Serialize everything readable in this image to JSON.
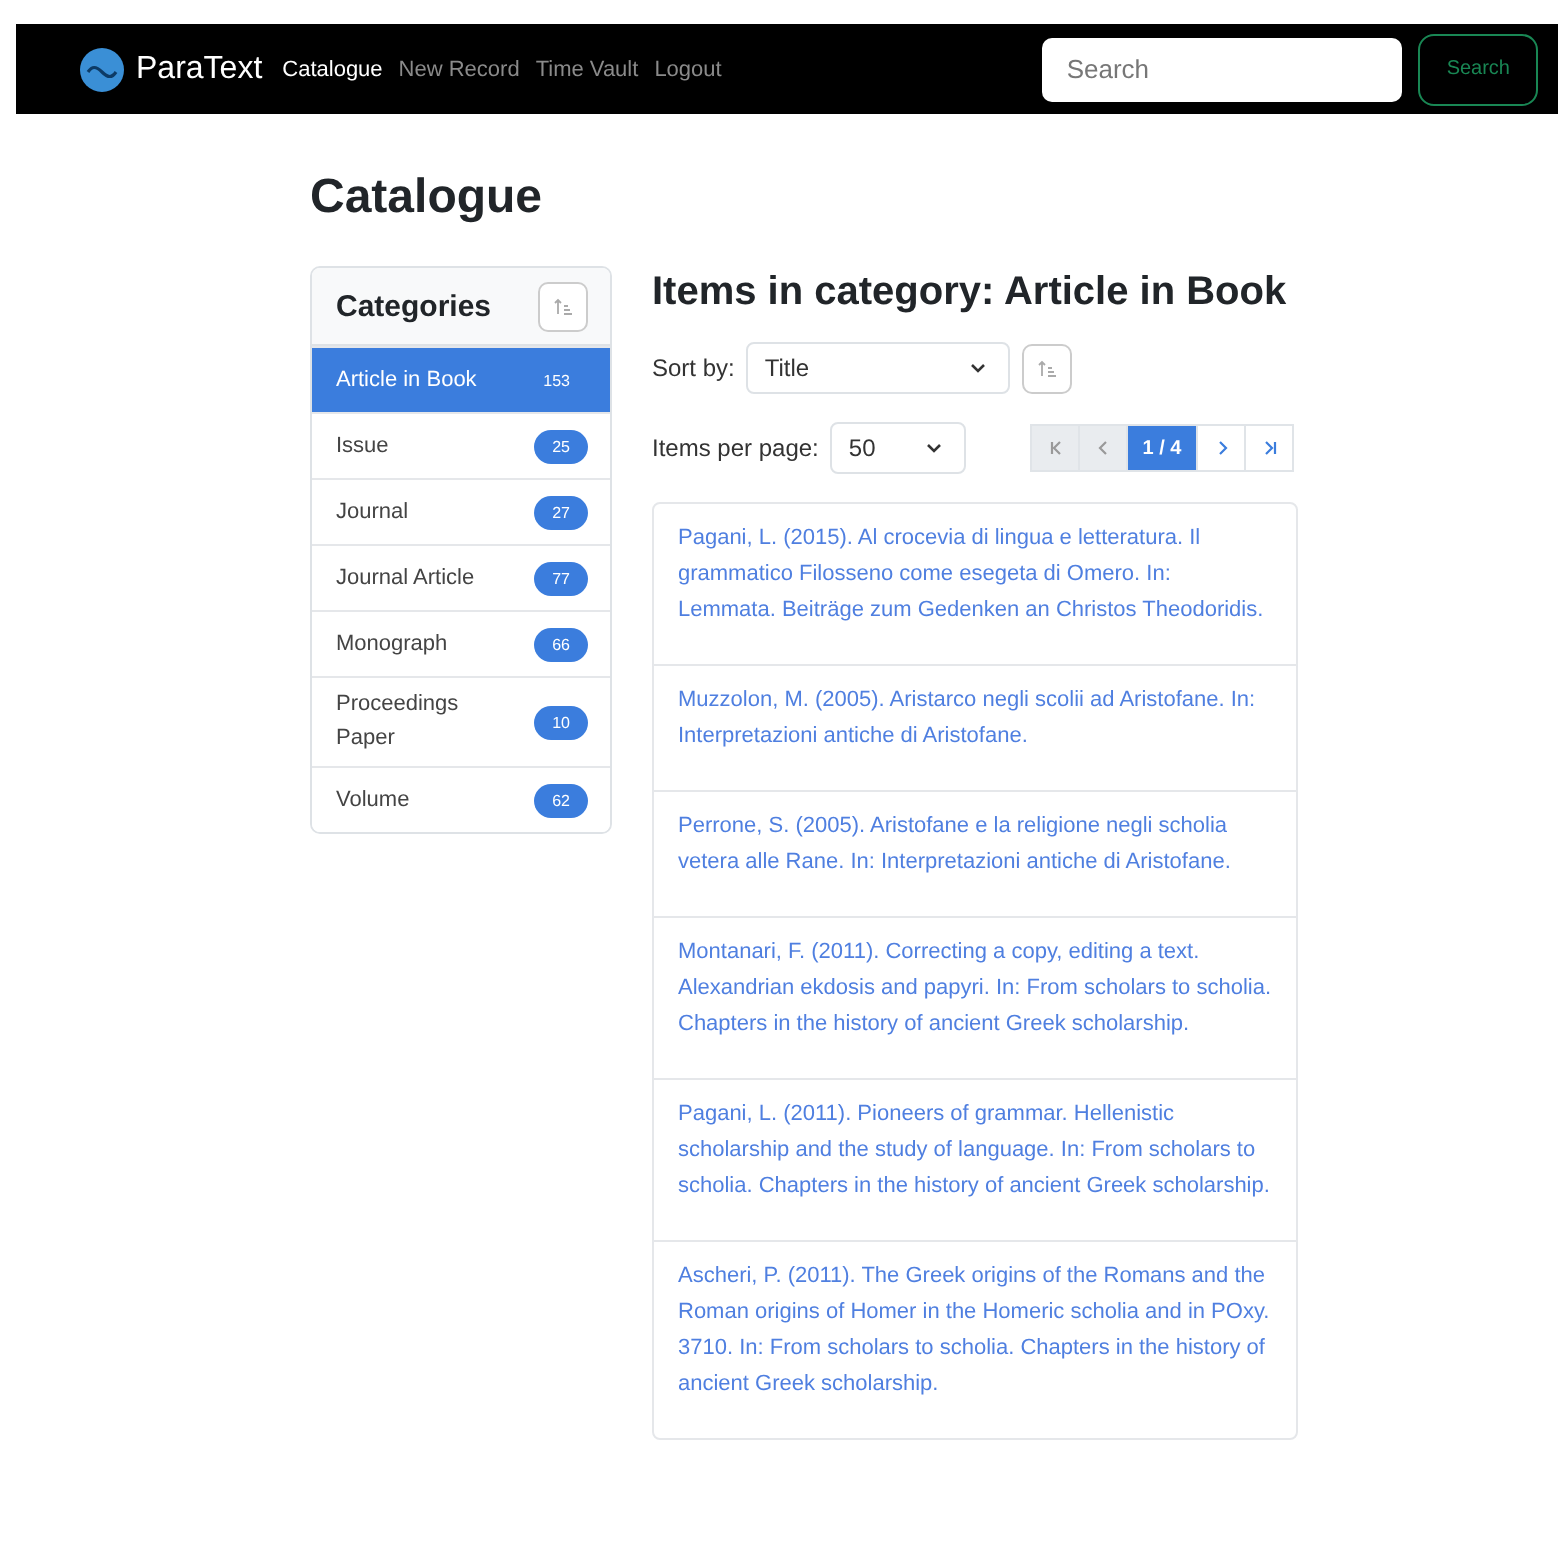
{
  "navbar": {
    "brand": "ParaText",
    "links": [
      {
        "label": "Catalogue",
        "selected": true
      },
      {
        "label": "New Record",
        "selected": false
      },
      {
        "label": "Time Vault",
        "selected": false
      },
      {
        "label": "Logout",
        "selected": false
      }
    ],
    "search": {
      "placeholder": "Search"
    },
    "search_button": "Search"
  },
  "page_title": "Catalogue",
  "categories": {
    "title": "Categories",
    "items": [
      {
        "label": "Article in Book",
        "count": "153",
        "selected": true
      },
      {
        "label": "Issue",
        "count": "25",
        "selected": false
      },
      {
        "label": "Journal",
        "count": "27",
        "selected": false
      },
      {
        "label": "Journal Article",
        "count": "77",
        "selected": false
      },
      {
        "label": "Monograph",
        "count": "66",
        "selected": false
      },
      {
        "label": "Proceedings Paper",
        "count": "10",
        "selected": false
      },
      {
        "label": "Volume",
        "count": "62",
        "selected": false
      }
    ]
  },
  "items": {
    "title": "Items in category: Article in Book",
    "sort_label": "Sort by:",
    "sort_value": "Title",
    "per_page_label": "Items per page:",
    "per_page_value": "50",
    "pagination": [
      {
        "kind": "first",
        "selected": false,
        "disabled": true
      },
      {
        "kind": "prev",
        "selected": false,
        "disabled": true
      },
      {
        "kind": "page",
        "label": "1 / 4",
        "selected": true,
        "disabled": false
      },
      {
        "kind": "next",
        "selected": false,
        "disabled": false
      },
      {
        "kind": "last",
        "selected": false,
        "disabled": false
      }
    ],
    "records": [
      "Pagani, L. (2015). Al crocevia di lingua e letteratura. Il grammatico Filosseno come esegeta di Omero. In: Lemmata. Beiträge zum Gedenken an Christos Theodoridis.",
      "Muzzolon, M. (2005). Aristarco negli scolii ad Aristofane. In: Interpretazioni antiche di Aristofane.",
      "Perrone, S. (2005). Aristofane e la religione negli scholia vetera alle Rane. In: Interpretazioni antiche di Aristofane.",
      "Montanari, F. (2011). Correcting a copy, editing a text. Alexandrian ekdosis and papyri. In: From scholars to scholia. Chapters in the history of ancient Greek scholarship.",
      "Pagani, L. (2011). Pioneers of grammar. Hellenistic scholarship and the study of language. In: From scholars to scholia. Chapters in the history of ancient Greek scholarship.",
      "Ascheri, P. (2011). The Greek origins of the Romans and the Roman origins of Homer in the Homeric scholia and in POxy. 3710. In: From scholars to scholia. Chapters in the history of ancient Greek scholarship."
    ]
  }
}
